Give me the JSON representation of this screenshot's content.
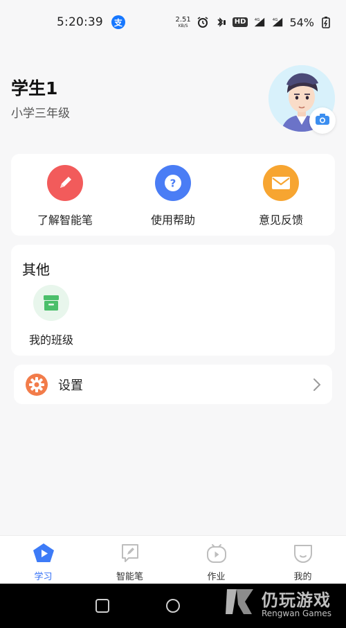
{
  "status_bar": {
    "time": "5:20:39",
    "net_speed_value": "2.51",
    "net_speed_unit": "KB/S",
    "hd_badge": "HD",
    "battery": "54%"
  },
  "profile": {
    "name": "学生1",
    "grade": "小学三年级"
  },
  "quick_actions": [
    {
      "label": "了解智能笔",
      "icon": "pencil-icon",
      "color": "#f25b5b"
    },
    {
      "label": "使用帮助",
      "icon": "help-icon",
      "color": "#4a7df5"
    },
    {
      "label": "意见反馈",
      "icon": "mail-icon",
      "color": "#f7a531"
    }
  ],
  "other": {
    "title": "其他",
    "my_class_label": "我的班级"
  },
  "settings": {
    "label": "设置"
  },
  "tabs": [
    {
      "label": "学习",
      "icon": "play-pentagon-icon",
      "active": true
    },
    {
      "label": "智能笔",
      "icon": "pen-note-icon",
      "active": false
    },
    {
      "label": "作业",
      "icon": "video-icon",
      "active": false
    },
    {
      "label": "我的",
      "icon": "smile-face-icon",
      "active": false
    }
  ],
  "watermark": {
    "cn": "仍玩游戏",
    "en": "Rengwan Games"
  },
  "colors": {
    "accent": "#2f6df6",
    "background": "#f7f7f8",
    "card": "#ffffff"
  }
}
